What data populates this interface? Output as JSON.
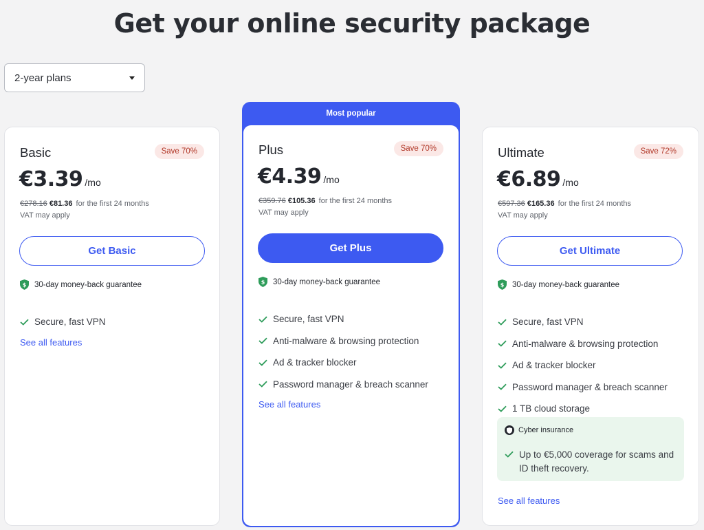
{
  "title": "Get your online security package",
  "plan_select": {
    "value": "2-year plans"
  },
  "plans": {
    "basic": {
      "name": "Basic",
      "save": "Save 70%",
      "price": "€3.39",
      "per": "/mo",
      "old_price": "€278.16",
      "new_price": "€81.36",
      "term": "for the first 24 months",
      "vat": "VAT may apply",
      "cta": "Get Basic",
      "guarantee": "30-day money-back guarantee",
      "features": [
        "Secure, fast VPN"
      ],
      "see_all": "See all features"
    },
    "plus": {
      "banner": "Most popular",
      "name": "Plus",
      "save": "Save 70%",
      "price": "€4.39",
      "per": "/mo",
      "old_price": "€359.76",
      "new_price": "€105.36",
      "term": "for the first 24 months",
      "vat": "VAT may apply",
      "cta": "Get Plus",
      "guarantee": "30-day money-back guarantee",
      "features": [
        "Secure, fast VPN",
        "Anti-malware & browsing protection",
        "Ad & tracker blocker",
        "Password manager & breach scanner"
      ],
      "see_all": "See all features"
    },
    "ultimate": {
      "name": "Ultimate",
      "save": "Save 72%",
      "price": "€6.89",
      "per": "/mo",
      "old_price": "€597.36",
      "new_price": "€165.36",
      "term": "for the first 24 months",
      "vat": "VAT may apply",
      "cta": "Get Ultimate",
      "guarantee": "30-day money-back guarantee",
      "features": [
        "Secure, fast VPN",
        "Anti-malware & browsing protection",
        "Ad & tracker blocker",
        "Password manager & breach scanner",
        "1 TB cloud storage"
      ],
      "insurance_title": "Cyber insurance",
      "insurance_text": "Up to €5,000 coverage for scams and ID theft recovery.",
      "see_all": "See all features"
    }
  },
  "colors": {
    "accent": "#3d5af1",
    "check": "#2e9c5a",
    "save_bg": "#fbe8e6",
    "save_text": "#b03626",
    "insurance_bg": "#eaf6ed"
  }
}
